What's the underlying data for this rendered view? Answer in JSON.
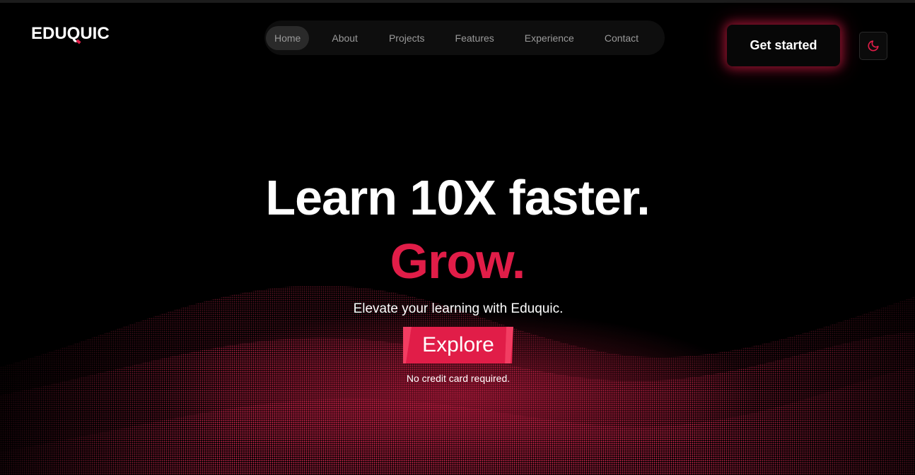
{
  "brand": {
    "logo_text_1": "EDU",
    "logo_text_q": "Q",
    "logo_text_2": "UIC",
    "accent": "#e11d48"
  },
  "nav": {
    "items": [
      {
        "label": "Home",
        "active": true
      },
      {
        "label": "About",
        "active": false
      },
      {
        "label": "Projects",
        "active": false
      },
      {
        "label": "Features",
        "active": false
      },
      {
        "label": "Experience",
        "active": false
      },
      {
        "label": "Contact",
        "active": false
      }
    ]
  },
  "header": {
    "cta_label": "Get started",
    "theme_toggle_icon": "moon-icon"
  },
  "hero": {
    "headline": "Learn 10X faster.",
    "headline_accent": "Grow.",
    "subheadline": "Elevate your learning with Eduquic.",
    "explore_label": "Explore",
    "note": "No credit card required."
  }
}
